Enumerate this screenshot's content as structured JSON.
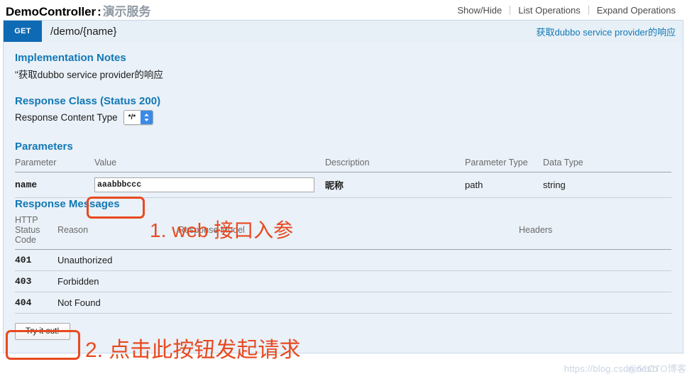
{
  "header": {
    "controller_name": "DemoController",
    "separator": ":",
    "controller_subtitle": "演示服务",
    "options": [
      {
        "label": "Show/Hide"
      },
      {
        "label": "List Operations"
      },
      {
        "label": "Expand Operations"
      }
    ]
  },
  "operation": {
    "method": "GET",
    "path": "/demo/{name}",
    "summary": "获取dubbo service provider的响应"
  },
  "implementation_notes": {
    "heading": "Implementation Notes",
    "text": "\"获取dubbo service provider的响应"
  },
  "response_class": {
    "heading": "Response Class (Status 200)",
    "content_type_label": "Response Content Type",
    "content_type_value": "*/*",
    "content_type_options": [
      "*/*"
    ]
  },
  "parameters": {
    "heading": "Parameters",
    "columns": [
      "Parameter",
      "Value",
      "Description",
      "Parameter Type",
      "Data Type"
    ],
    "rows": [
      {
        "parameter": "name",
        "value": "aaabbbccc",
        "placeholder": "",
        "description": "昵称",
        "parameter_type": "path",
        "data_type": "string"
      }
    ]
  },
  "response_messages": {
    "heading": "Response Messages",
    "columns": [
      "HTTP Status Code",
      "Reason",
      "Response Model",
      "Headers"
    ],
    "rows": [
      {
        "code": "401",
        "reason": "Unauthorized",
        "model": "",
        "headers": ""
      },
      {
        "code": "403",
        "reason": "Forbidden",
        "model": "",
        "headers": ""
      },
      {
        "code": "404",
        "reason": "Not Found",
        "model": "",
        "headers": ""
      }
    ]
  },
  "actions": {
    "try_it_out": "Try it out!"
  },
  "annotations": [
    {
      "id": "annot-1",
      "text": "1. web 接口入参",
      "color": "#e8491f"
    },
    {
      "id": "annot-2",
      "text": "2. 点击此按钮发起请求",
      "color": "#e8491f"
    }
  ],
  "watermark": {
    "url_text": "https://blog.csdn.net/b",
    "site_text": "@51CTO博客"
  },
  "colors": {
    "method_badge": "#0f6ab4",
    "link_blue": "#1278b5",
    "panel_bg": "#eaf1f8",
    "panel_border": "#c8d9e8",
    "annotation_red": "#e8491f",
    "select_arrow_blue": "#3b89e8"
  }
}
